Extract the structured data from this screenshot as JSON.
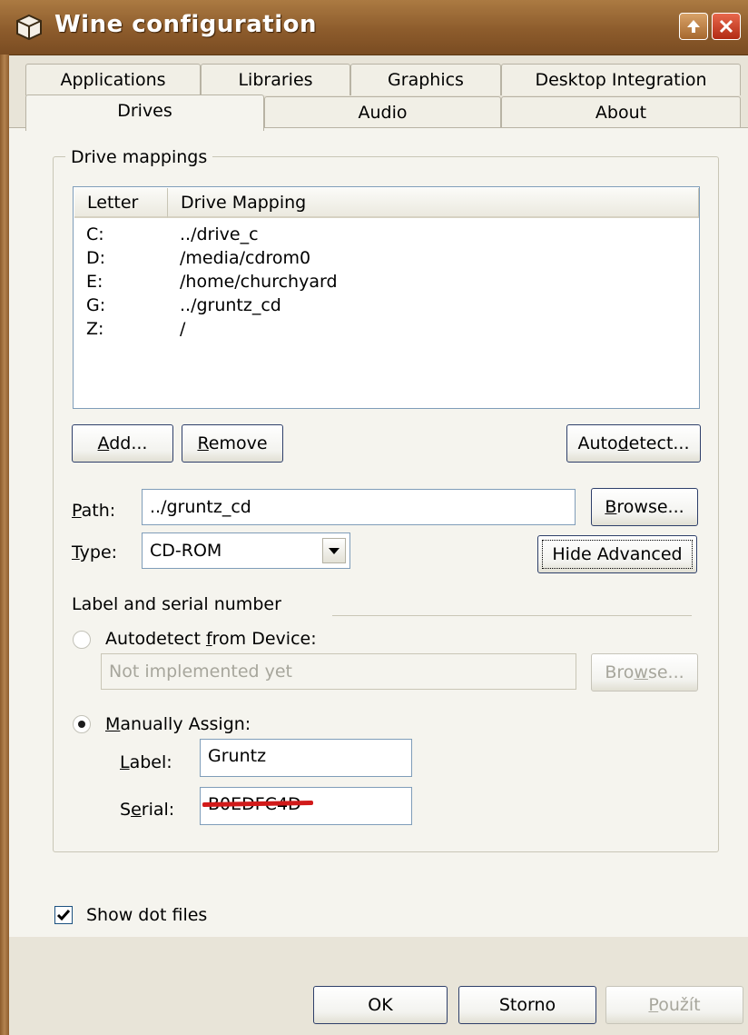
{
  "window": {
    "title": "Wine configuration"
  },
  "tabs": {
    "row1": [
      "Applications",
      "Libraries",
      "Graphics",
      "Desktop Integration"
    ],
    "row2": [
      "Drives",
      "Audio",
      "About"
    ]
  },
  "drive_mappings": {
    "legend": "Drive mappings",
    "columns": [
      "Letter",
      "Drive Mapping"
    ],
    "rows": [
      {
        "letter": "C:",
        "mapping": "../drive_c"
      },
      {
        "letter": "D:",
        "mapping": "/media/cdrom0"
      },
      {
        "letter": "E:",
        "mapping": "/home/churchyard"
      },
      {
        "letter": "G:",
        "mapping": "../gruntz_cd"
      },
      {
        "letter": "Z:",
        "mapping": "/"
      }
    ],
    "add": {
      "pre": "",
      "u": "A",
      "post": "dd..."
    },
    "remove": {
      "pre": "",
      "u": "R",
      "post": "emove"
    },
    "autodetect": {
      "pre": "Auto",
      "u": "d",
      "post": "etect..."
    }
  },
  "path": {
    "label": {
      "pre": "",
      "u": "P",
      "post": "ath:"
    },
    "value": "../gruntz_cd",
    "browse": {
      "pre": "",
      "u": "B",
      "post": "rowse..."
    }
  },
  "type": {
    "label": {
      "pre": "",
      "u": "T",
      "post": "ype:"
    },
    "value": "CD-ROM",
    "hide_advanced": "Hide Advanced"
  },
  "serial_section": {
    "title": "Label and serial number",
    "autodetect_radio": {
      "pre": "Autodetect ",
      "u": "f",
      "post": "rom Device:"
    },
    "device_placeholder": "Not implemented yet",
    "browse_disabled": {
      "pre": "Bro",
      "u": "w",
      "post": "se..."
    },
    "manual_radio": {
      "pre": "",
      "u": "M",
      "post": "anually Assign:"
    },
    "label_label": {
      "pre": "",
      "u": "L",
      "post": "abel:"
    },
    "label_value": "Gruntz",
    "serial_label": {
      "pre": "S",
      "u": "e",
      "post": "rial:"
    },
    "serial_value": "B0EDFC4D"
  },
  "show_dot_files": "Show dot files",
  "footer": {
    "ok": "OK",
    "cancel": "Storno",
    "apply": {
      "pre": "",
      "u": "P",
      "post": "oužít"
    }
  },
  "colors": {
    "titlebar": "#8d5c2c",
    "redact": "#d11a1a"
  }
}
